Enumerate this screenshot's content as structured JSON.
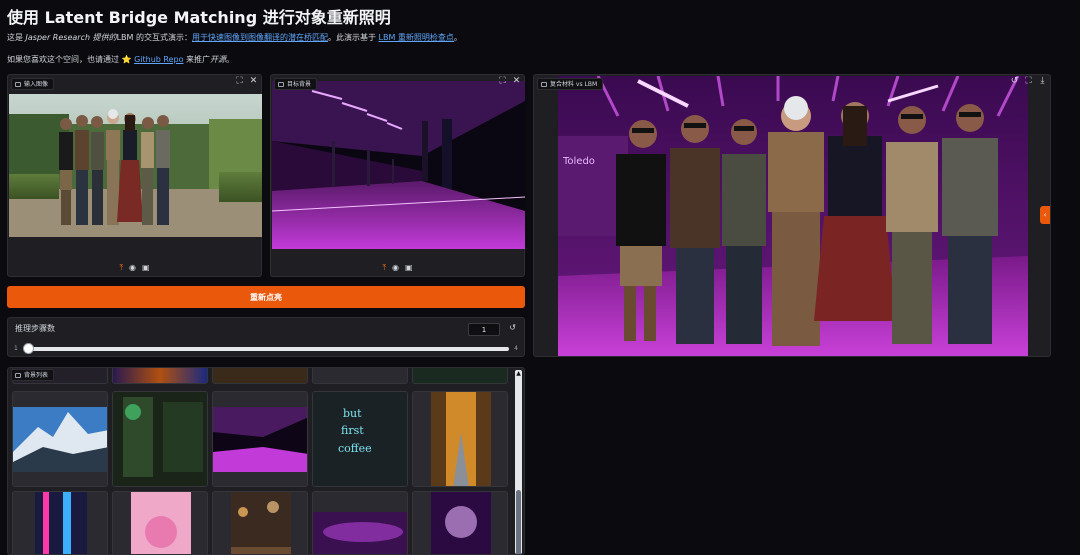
{
  "header": {
    "title": "使用 Latent Bridge Matching 进行对象重新照明",
    "desc_prefix": "这是 ",
    "desc_em": "Jasper Research 提供的",
    "desc_mid": "LBM 的交互式演示：",
    "desc_link1": "用于快速图像到图像翻译的潜在桥匹配",
    "desc_mid2": "。此演示基于 ",
    "desc_link2": "LBM 重新照明检查点",
    "desc_end": "。",
    "like_prefix": "如果您喜欢这个空间，也请通过 ",
    "like_star": "⭐",
    "like_link": "Github Repo",
    "like_suffix": " 来推广",
    "like_em": "开源",
    "like_end": "。"
  },
  "input_panel": {
    "label": "输入图像"
  },
  "target_panel": {
    "label": "目标背景"
  },
  "output_panel": {
    "label": "复合材料 vs LBM",
    "sign_text": "Toledo"
  },
  "actions": {
    "relight_label": "重新点亮"
  },
  "steps": {
    "label": "推理步骤数",
    "value": "1",
    "min": "1",
    "max": "4",
    "fraction": 0.0
  },
  "gallery": {
    "label": "背景列表"
  },
  "icons": {
    "upload": "upload-icon",
    "webcam": "webcam-icon",
    "clipboard": "clipboard-icon",
    "fullscreen": "fullscreen-icon",
    "close": "close-icon",
    "reset": "reset-icon",
    "undo": "undo-icon",
    "download": "download-icon",
    "image": "image-icon"
  },
  "colors": {
    "accent": "#ea580c",
    "link": "#60a5fa",
    "background": "#0b0b0f",
    "panel": "#1f1f23"
  }
}
